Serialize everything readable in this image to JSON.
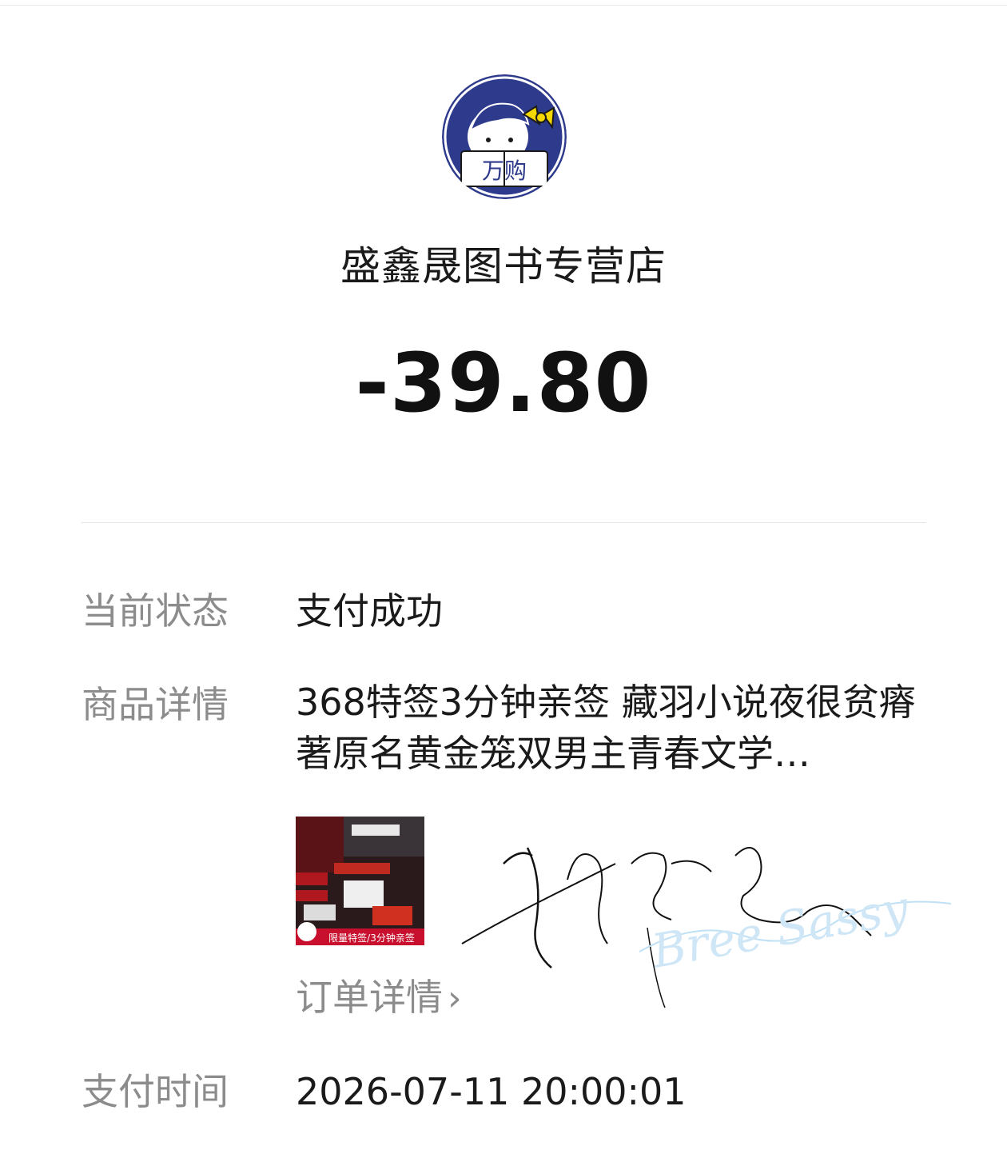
{
  "shop": {
    "logo_text": "万购",
    "name": "盛鑫晟图书专营店"
  },
  "amount": "-39.80",
  "details": {
    "status_label": "当前状态",
    "status_value": "支付成功",
    "goods_label": "商品详情",
    "goods_desc": "368特签3分钟亲签 藏羽小说夜很贫瘠著原名黄金笼双男主青春文学…",
    "thumb_caption": "限量特签/3分钟亲签",
    "order_link": "订单详情",
    "pay_time_label": "支付时间",
    "pay_time_value": "2026-07-11 20:00:01"
  },
  "icons": {
    "chevron": "chevron-right-icon"
  },
  "colors": {
    "logo_bg": "#2e3a8c",
    "label_gray": "#8c8c8c",
    "text_dark": "#1a1a1a"
  },
  "watermark_text": "Bree Sassy"
}
